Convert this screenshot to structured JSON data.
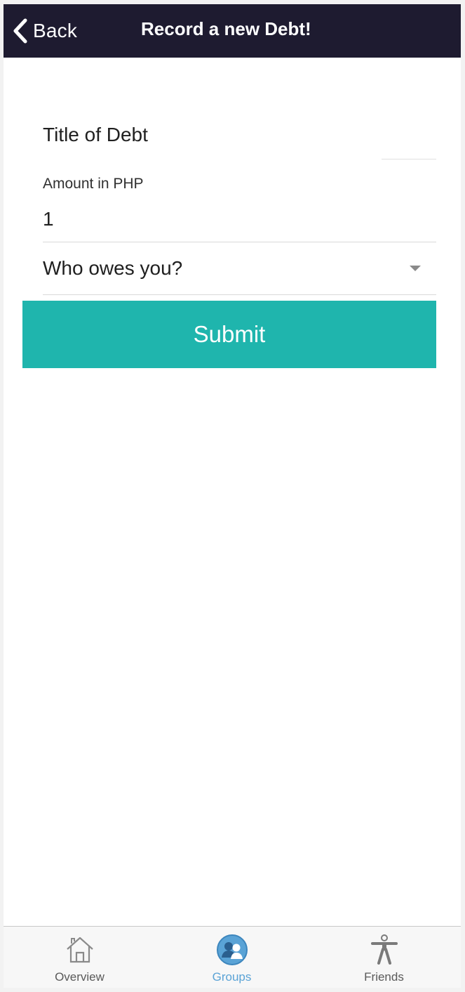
{
  "header": {
    "back_label": "Back",
    "title": "Record a new Debt!"
  },
  "form": {
    "title_placeholder": "Title of Debt",
    "amount_label": "Amount in PHP",
    "amount_value": "1",
    "who_placeholder": "Who owes you?",
    "submit_label": "Submit"
  },
  "tabs": [
    {
      "label": "Overview",
      "icon": "home-icon",
      "active": false
    },
    {
      "label": "Groups",
      "icon": "groups-icon",
      "active": true
    },
    {
      "label": "Friends",
      "icon": "person-icon",
      "active": false
    }
  ],
  "colors": {
    "navbar": "#1e1b30",
    "submit": "#1fb5ad",
    "active_tab": "#5aa3d6"
  }
}
